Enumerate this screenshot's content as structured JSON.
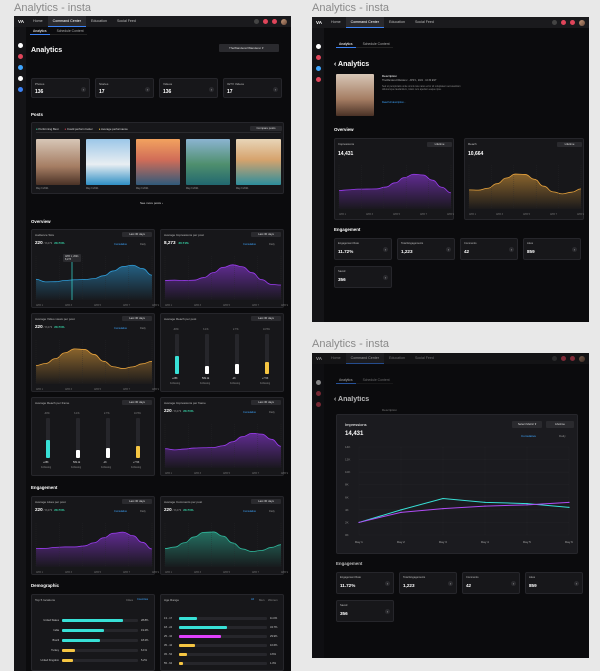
{
  "frames": {
    "left": "Analytics - insta",
    "top_right": "Analytics - insta",
    "bottom_right": "Analytics - insta"
  },
  "colors": {
    "bg": "#0b0b0d",
    "card": "#17171a",
    "cyan": "#38e0d6",
    "purple": "#9b3cf0",
    "orange": "#e6a23c",
    "accent": "#3b82f6",
    "green": "#38e0b0",
    "pink": "#e040fb",
    "yellow": "#f5c542"
  },
  "topbar": {
    "logo": "VA",
    "nav": [
      "Home",
      "Command Center",
      "Education",
      "Social Feed"
    ]
  },
  "subtabs": [
    "Analytics",
    "Schedule Content"
  ],
  "left": {
    "title": "Analytics",
    "account_select": "TheWanderer/Wanderer",
    "stats": [
      {
        "label": "Photos",
        "value": "136"
      },
      {
        "label": "Stories",
        "value": "17"
      },
      {
        "label": "Videos",
        "value": "136"
      },
      {
        "label": "IGTV Videos",
        "value": "17"
      }
    ],
    "posts_title": "Posts",
    "post_filters": [
      "Performing Best",
      "Could perform better",
      "Average performance"
    ],
    "compare_label": "Compare posts",
    "post_dates": [
      "May 3 2021",
      "May 3 2021",
      "May 3 2021",
      "May 3 2021",
      "May 3 2021"
    ],
    "see_more": "See more posts",
    "overview_title": "Overview",
    "range_label": "Last 30 days",
    "cumulative": "Cumulative",
    "daily": "Daily",
    "overview_cards": [
      {
        "title": "Audience Size",
        "value": "220",
        "sub": "/ 8,273",
        "pct": "20.71%"
      },
      {
        "title": "Average Impressions per post",
        "value": "8,273",
        "sub": "",
        "pct": "20.71%"
      },
      {
        "title": "Average Video views per post",
        "value": "220",
        "sub": "/ 8,273",
        "pct": "20.71%"
      },
      {
        "title": "Average Reach per post",
        "value": "",
        "sub": "",
        "pct": ""
      },
      {
        "title": "Average Reach per frame",
        "value": "",
        "sub": "",
        "pct": ""
      },
      {
        "title": "Average Impressions per frame",
        "value": "220",
        "sub": "/ 8,273",
        "pct": "20.71%"
      }
    ],
    "tooltip": {
      "date": "APR 1, 2021",
      "value": "8,273"
    },
    "x_ticks": [
      "APR 1",
      "APR 3",
      "APR 5",
      "APR 7",
      "APR 9"
    ],
    "reach_bars": {
      "percents": [
        "-30%",
        "3.1%",
        "2.7%",
        "10.5%"
      ],
      "values": [
        "+28K",
        "509.1k",
        "-1K",
        "+7.5K"
      ],
      "label": "Following"
    },
    "engagement_title": "Engagement",
    "engagement_cards": [
      {
        "title": "Average Likes per post",
        "value": "220",
        "sub": "/ 8,273",
        "pct": "20.71%"
      },
      {
        "title": "Average Comments per post",
        "value": "220",
        "sub": "/ 8,273",
        "pct": "20.71%"
      }
    ],
    "demographic_title": "Demographic",
    "top_locations": {
      "title": "Top 5 locations",
      "tabs": [
        "Cities",
        "Countries"
      ],
      "rows": [
        {
          "name": "United States",
          "pct": "28.8%",
          "v": 0.8
        },
        {
          "name": "India",
          "pct": "19.2%",
          "v": 0.55
        },
        {
          "name": "Brazil",
          "pct": "18.2%",
          "v": 0.5
        },
        {
          "name": "Turkey",
          "pct": "6.1%",
          "v": 0.17
        },
        {
          "name": "United Kingdom",
          "pct": "5.2%",
          "v": 0.15
        }
      ]
    },
    "age_range": {
      "title": "Age Range",
      "tabs": [
        "All",
        "Men",
        "Women"
      ],
      "rows": [
        {
          "name": "13 - 17",
          "pct": "11.0%",
          "v": 0.2
        },
        {
          "name": "18 - 24",
          "pct": "34.7%",
          "v": 0.55
        },
        {
          "name": "25 - 34",
          "pct": "29.9%",
          "v": 0.48
        },
        {
          "name": "35 - 44",
          "pct": "10.6%",
          "v": 0.18
        },
        {
          "name": "45 - 54",
          "pct": "4.6%",
          "v": 0.09
        },
        {
          "name": "55 - 64",
          "pct": "1.3%",
          "v": 0.04
        }
      ]
    }
  },
  "top_right": {
    "title": "Analytics",
    "desc_title": "Description",
    "desc_meta": "TheWanderer/Wanderer · APR 1, 2021 · 10:30 EST",
    "desc_text": "Sed ut perspiciatis unde omnis iste natus error sit voluptatem accusantium doloremque laudantium, totam rem aperiam eaque ipsa.",
    "read_more": "Read full description...",
    "overview_title": "Overview",
    "lifetime": "Lifetime",
    "impressions": {
      "label": "Impressions",
      "value": "14,431"
    },
    "reach": {
      "label": "Reach",
      "value": "10,664"
    },
    "engagement_title": "Engagement",
    "eng": [
      {
        "label": "Engagement Rate",
        "value": "11.72%"
      },
      {
        "label": "Total Engagements",
        "value": "1,223"
      },
      {
        "label": "Comments",
        "value": "42"
      },
      {
        "label": "Likes",
        "value": "859"
      }
    ],
    "saved": {
      "label": "Saved",
      "value": "356"
    }
  },
  "bottom_right": {
    "title": "Analytics",
    "tab_desc": "Description",
    "imp_label": "Impressions",
    "imp_value": "14,431",
    "select_metric": "Select Metric",
    "lifetime": "Lifetime",
    "cumulative": "Cumulative",
    "daily": "Daily",
    "y_ticks": [
      "14K",
      "12K",
      "10K",
      "8K",
      "6K",
      "4K",
      "2K",
      "0K"
    ],
    "x_ticks": [
      "Day 1",
      "Day 2",
      "Day 3",
      "Day 4",
      "Day 5",
      "Day 6"
    ],
    "engagement_title": "Engagement",
    "eng": [
      {
        "label": "Engagement Rate",
        "value": "11.72%"
      },
      {
        "label": "Total Engagements",
        "value": "1,223"
      },
      {
        "label": "Comments",
        "value": "42"
      },
      {
        "label": "Likes",
        "value": "859"
      }
    ],
    "saved": {
      "label": "Saved",
      "value": "356"
    }
  },
  "chart_data": [
    {
      "type": "line",
      "x": [
        "Day 1",
        "Day 2",
        "Day 3",
        "Day 4",
        "Day 5",
        "Day 6"
      ],
      "series": [
        {
          "values": [
            2000,
            4000,
            5800,
            5200,
            5000,
            4400
          ]
        },
        {
          "values": [
            2000,
            3600,
            4200,
            4600,
            4800,
            5200
          ]
        }
      ],
      "ylim": [
        0,
        14000
      ],
      "ylabel": "",
      "xlabel": ""
    }
  ]
}
